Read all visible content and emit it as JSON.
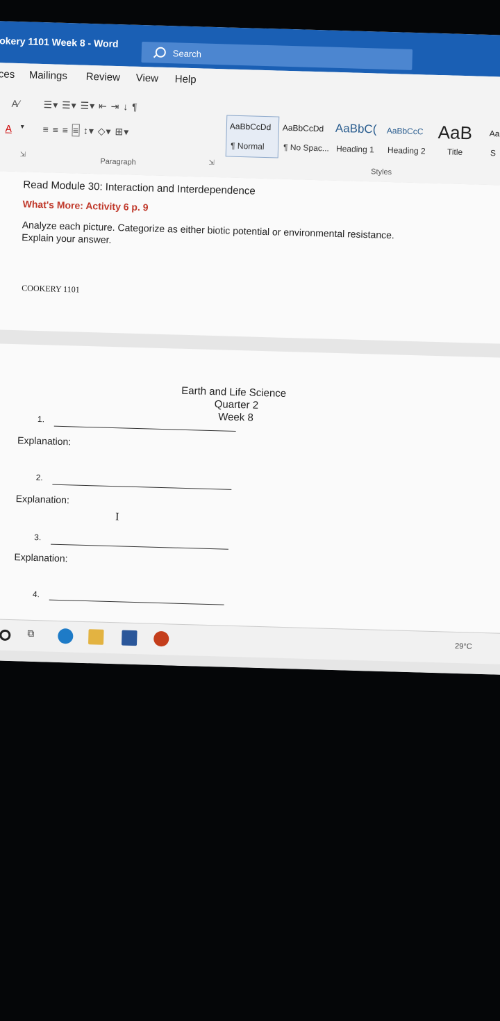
{
  "window": {
    "title": "okery 1101 Week 8  -  Word"
  },
  "search": {
    "label": "Search"
  },
  "menu": {
    "items": [
      "ces",
      "Mailings",
      "Review",
      "View",
      "Help"
    ]
  },
  "ribbon": {
    "paragraph_label": "Paragraph",
    "styles_label": "Styles",
    "styles": [
      {
        "preview": "AaBbCcDd",
        "name": "¶ Normal"
      },
      {
        "preview": "AaBbCcDd",
        "name": "¶ No Spac..."
      },
      {
        "preview": "AaBbC(",
        "name": "Heading 1"
      },
      {
        "preview": "AaBbCcC",
        "name": "Heading 2"
      },
      {
        "preview": "AaB",
        "name": "Title"
      }
    ],
    "overflow_preview": "Aa",
    "overflow_name": "S"
  },
  "document": {
    "line1": "Read Module 30: Interaction and Interdependence",
    "line2": "What's More: Activity 6 p. 9",
    "line3": "Analyze each picture. Categorize as either biotic potential or environmental resistance.",
    "line4": "Explain your answer.",
    "footer": "COOKERY 1101",
    "page2_title1": "Earth and Life Science",
    "page2_title2": "Quarter 2",
    "page2_title3": "Week 8",
    "items": [
      {
        "num": "1.",
        "explanation": "Explanation:"
      },
      {
        "num": "2.",
        "explanation": "Explanation:"
      },
      {
        "num": "3.",
        "explanation": "Explanation:"
      },
      {
        "num": "4.",
        "explanation": ""
      }
    ]
  },
  "taskbar": {
    "temperature": "29°C"
  },
  "colors": {
    "accent": "#1a5fb4",
    "heading_red": "#c0392b"
  }
}
